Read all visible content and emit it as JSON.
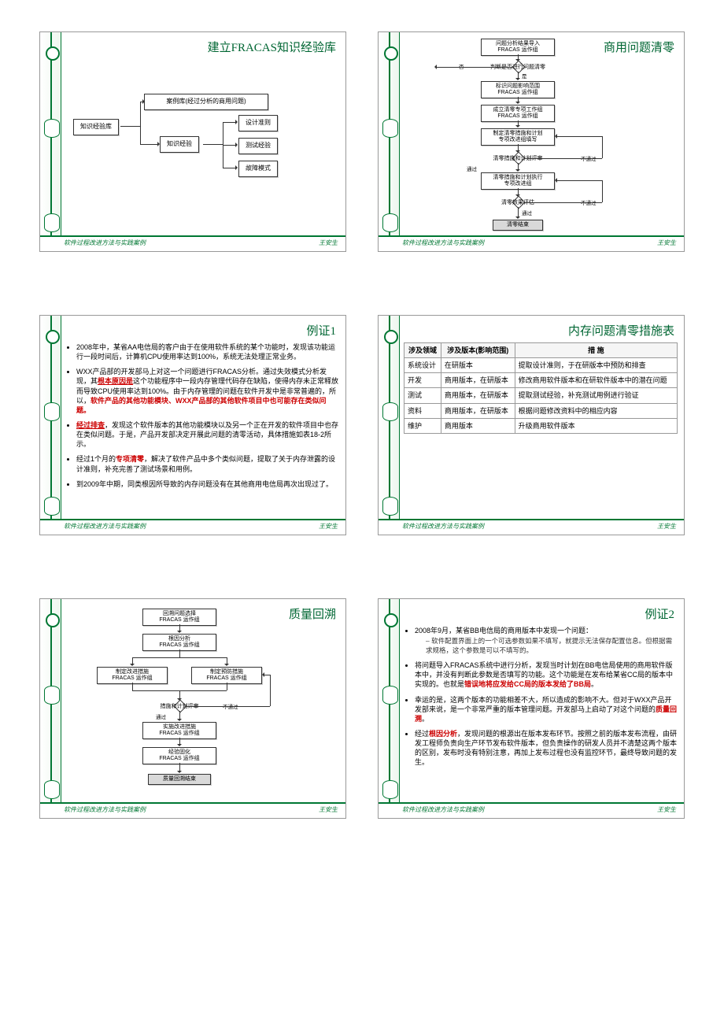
{
  "footer": {
    "left": "软件过程改进方法与实践案例",
    "right": "王安生"
  },
  "slide1": {
    "title": "建立FRACAS知识经验库",
    "tree": {
      "root": "知识经验库",
      "b1": "案例库(经过分析的商用问题)",
      "b2": "知识经验",
      "c1": "设计准则",
      "c2": "测试经验",
      "c3": "故障模式"
    }
  },
  "slide2": {
    "title": "商用问题清零",
    "flow": {
      "n1": "问题分析结果导入\nFRACAS 运作组",
      "d1": "判断是否进行问题清零",
      "n2": "标识问题影响范围\nFRACAS 运作组",
      "n3": "成立清零专项工作组\nFRACAS 运作组",
      "n4": "制定清零措施和计划\n专项改进组填写",
      "d2": "清零措施和计划评审",
      "n5": "清零措施和计划执行\n专项改进组",
      "d3": "清零效果评估",
      "end": "清零结束",
      "yes": "是",
      "no": "否",
      "pass": "通过",
      "fail": "不通过"
    }
  },
  "slide3": {
    "title": "例证1",
    "items": [
      "2008年中，某省AA电信局的客户由于在使用软件系统的某个功能时，发现该功能运行一段时间后，计算机CPU使用率达到100%，系统无法处理正常业务。",
      "WXX产品部的开发部马上对这一个问题进行FRACAS分析。通过失效模式分析发现，其<span class='redu'>根本原因是</span>这个功能程序中一段内存管理代码存在缺陷，使得内存未正常释放而导致CPU使用率达到100%。由于内存管理的问题在软件开发中是非常普遍的，所以，<span class='red'>软件产品的其他功能模块、WXX产品部的其他软件项目中也可能存在类似问题。</span>",
      "<span class='redu'>经过排查</span>，发现这个软件版本的其他功能模块以及另一个正在开发的软件项目中也存在类似问题。于是，产品开发部决定开展此问题的清零活动，具体措施如表18-2所示。",
      "经过1个月的<span class='red'>专项清零</span>，解决了软件产品中多个类似问题，提取了关于内存泄露的设计准则，补充完善了测试场景和用例。",
      "到2009年中期，同类根因所导致的内存问题没有在其他商用电信局再次出现过了。"
    ]
  },
  "slide4": {
    "title": "内存问题清零措施表",
    "headers": [
      "涉及领域",
      "涉及版本(影响范围)",
      "措 施"
    ],
    "rows": [
      [
        "系统设计",
        "在研版本",
        "提取设计准则，于在研版本中预防和排查"
      ],
      [
        "开发",
        "商用版本，在研版本",
        "修改商用软件版本和在研软件版本中的潜在问题"
      ],
      [
        "测试",
        "商用版本，在研版本",
        "提取测试经验，补充测试用例进行验证"
      ],
      [
        "资料",
        "商用版本，在研版本",
        "根据问题修改资料中的相应内容"
      ],
      [
        "维护",
        "商用版本",
        "升级商用软件版本"
      ]
    ]
  },
  "slide5": {
    "title": "质量回溯",
    "flow": {
      "n1": "回溯问题选择\nFRACAS 运作组",
      "n2": "根因分析\nFRACAS 运作组",
      "n3a": "制定改进措施\nFRACAS 运作组",
      "n3b": "制定预防措施\nFRACAS 运作组",
      "d1": "措施和计划评审",
      "n4": "实施改进措施\nFRACAS 运作组",
      "n5": "经验固化\nFRACAS 运作组",
      "end": "质量回溯结束",
      "pass": "通过",
      "fail": "不通过"
    }
  },
  "slide6": {
    "title": "例证2",
    "items": [
      {
        "text": "2008年9月，某省BB电信局的商用版本中发现一个问题：",
        "sub": [
          "软件配置界面上的一个可选参数如果不填写，就提示无法保存配置信息。但根据需求规格，这个参数是可以不填写的。"
        ]
      },
      {
        "text": "将问题导入FRACAS系统中进行分析，发现当时计划在BB电信局使用的商用软件版本中，并没有判断此参数是否填写的功能。这个功能是在发布给某省CC局的版本中实现的。也就是<span class='red'>错误地将应发给CC局的版本发给了BB局</span>。"
      },
      {
        "text": "幸运的是，这两个版本的功能相差不大，所以造成的影响不大。但对于WXX产品开发部来说，是一个非常严重的版本管理问题。开发部马上启动了对这个问题的<span class='red'>质量回溯</span>。"
      },
      {
        "text": "经过<span class='red'>根因分析</span>，发现问题的根源出在版本发布环节。按照之前的版本发布流程，由研发工程师负责向生产环节发布软件版本，但负责操作的研发人员并不清楚这两个版本的区别，发布时没有特别注意，再加上发布过程也没有监控环节，最终导致问题的发生。"
      }
    ]
  }
}
